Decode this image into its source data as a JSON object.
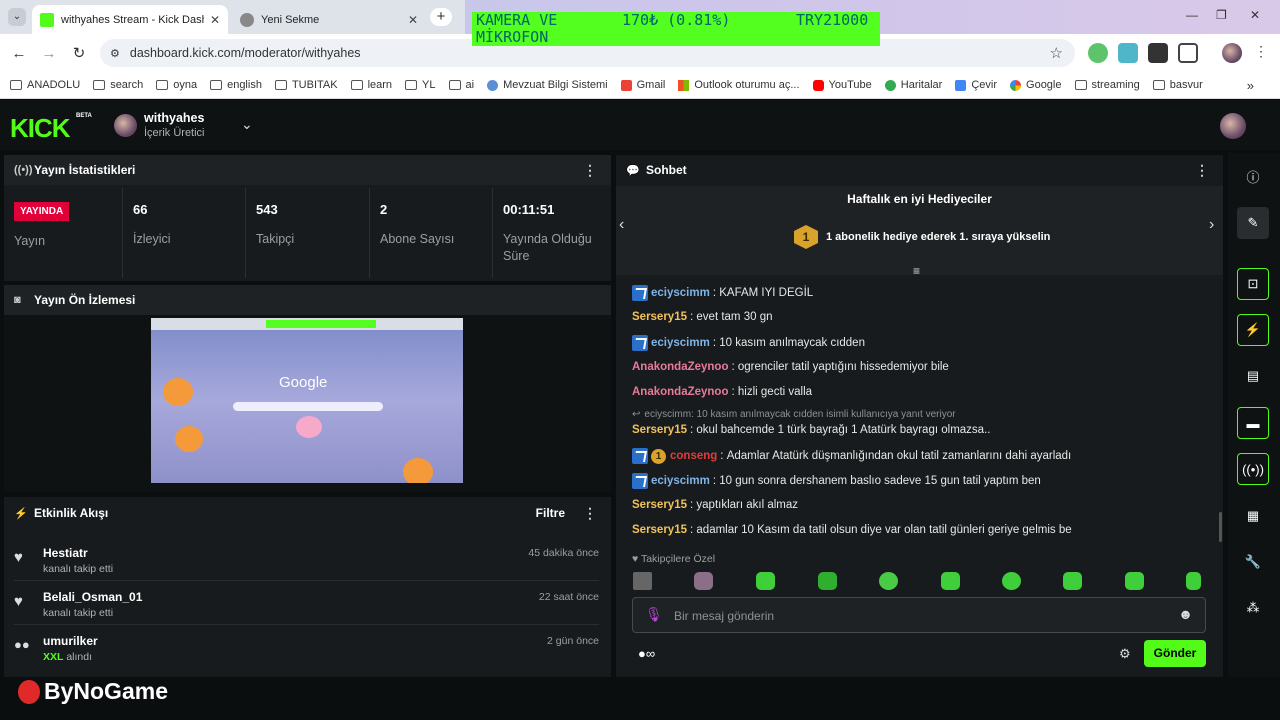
{
  "browser": {
    "tabs": [
      {
        "title": "withyahes Stream - Kick Dashb",
        "active": true,
        "favicon_color": "#53fc18"
      },
      {
        "title": "Yeni Sekme",
        "active": false,
        "favicon_color": "#777777"
      }
    ],
    "url": "dashboard.kick.com/moderator/withyahes",
    "ticker": {
      "text1": "KAMERA VE",
      "text2": "MİKROFON",
      "price": "170₺ (0.81%)",
      "goal": "TRY21000"
    },
    "bookmarks": [
      "ANADOLU",
      "search",
      "oyna",
      "english",
      "TUBITAK",
      "learn",
      "YL",
      "ai",
      "Mevzuat Bilgi Sistemi",
      "Gmail",
      "Outlook oturumu aç...",
      "YouTube",
      "Haritalar",
      "Çevir",
      "Google",
      "streaming",
      "basvur"
    ]
  },
  "header": {
    "logo": "KICK",
    "beta": "BETA",
    "channel_name": "withyahes",
    "channel_role": "İçerik Üretici"
  },
  "stats": {
    "title": "Yayın İstatistikleri",
    "live_badge": "YAYINDA",
    "items": [
      {
        "value": "",
        "label": "Yayın"
      },
      {
        "value": "66",
        "label": "İzleyici"
      },
      {
        "value": "543",
        "label": "Takipçi"
      },
      {
        "value": "2",
        "label": "Abone Sayısı"
      },
      {
        "value": "00:11:51",
        "label": "Yayında Olduğu Süre"
      }
    ]
  },
  "preview": {
    "title": "Yayın Ön İzlemesi",
    "google_text": "Google"
  },
  "activity": {
    "title": "Etkinlik Akışı",
    "filter": "Filtre",
    "items": [
      {
        "name": "Hestiatr",
        "sub": "kanalı takip etti",
        "time": "45 dakika önce"
      },
      {
        "name": "Belali_Osman_01",
        "sub": "kanalı takip etti",
        "time": "22 saat önce"
      },
      {
        "name": "umurilker",
        "sub_highlight": "XXL",
        "sub": "alındı",
        "time": "2 gün önce"
      }
    ]
  },
  "chat": {
    "title": "Sohbet",
    "gifters_title": "Haftalık en iyi Hediyeciler",
    "gift_rank": "1",
    "gift_text": "1 abonelik hediye ederek 1. sıraya yükselin",
    "messages": [
      {
        "user": "eciyscimm",
        "text": "KAFAM IYI DEGİL",
        "color": "#7fb4e8",
        "verified": true
      },
      {
        "user": "Sersery15",
        "text": "evet tam 30 gn",
        "color": "#f2c25a"
      },
      {
        "user": "eciyscimm",
        "text": "10 kasım anılmaycak cıdden",
        "color": "#7fb4e8",
        "verified": true
      },
      {
        "user": "AnakondaZeynoo",
        "text": "ogrenciler tatil yaptığını hissedemiyor bile",
        "color": "#e87a9a"
      },
      {
        "user": "AnakondaZeynoo",
        "text": "hizli gecti valla",
        "color": "#e87a9a"
      },
      {
        "reply": "eciyscimm: 10 kasım anılmaycak cıdden isimli kullanıcıya yanıt veriyor",
        "user": "Sersery15",
        "text": "okul bahcemde 1 türk bayrağı 1 Atatürk bayragı olmazsa..",
        "color": "#f2c25a"
      },
      {
        "user": "conseng",
        "text": "Adamlar Atatürk düşmanlığından okul tatil zamanlarını dahi ayarladı",
        "color": "#e33b3b",
        "verified": true,
        "badge": "1"
      },
      {
        "user": "eciyscimm",
        "text": "10 gun sonra dershanem baslıo sadeve 15 gun tatil yaptım ben",
        "color": "#7fb4e8",
        "verified": true
      },
      {
        "user": "Sersery15",
        "text": "yaptıkları akıl almaz",
        "color": "#f2c25a"
      },
      {
        "user": "Sersery15",
        "text": "adamlar 10 Kasım da tatil olsun diye var olan tatil günleri geriye gelmis be",
        "color": "#f2c25a"
      }
    ],
    "emote_section": "Takipçilere Özel",
    "input_placeholder": "Bir mesaj gönderin",
    "send": "Gönder"
  },
  "watermark": "ByNoGame",
  "colors": {
    "accent": "#53fc18",
    "live": "#e10039",
    "panel": "#181b1d",
    "background": "#0b0e0f"
  }
}
